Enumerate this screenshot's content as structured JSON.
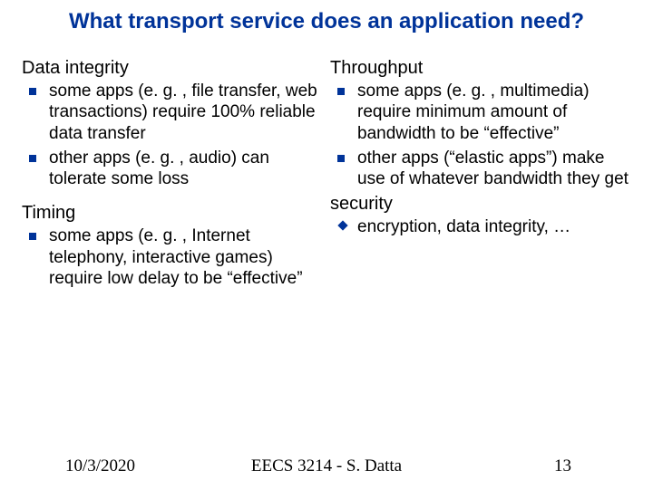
{
  "title": "What transport service does an application need?",
  "left": {
    "h1": "Data integrity",
    "b1": "some apps (e. g. , file transfer, web transactions) require 100% reliable data transfer",
    "b2": "other apps (e. g. , audio) can tolerate some loss",
    "h2": "Timing",
    "b3": "some apps (e. g. , Internet telephony, interactive games) require low delay to be “effective”"
  },
  "right": {
    "h1": "Throughput",
    "b1": "some apps (e. g. , multimedia) require minimum amount of bandwidth to be “effective”",
    "b2": "other apps (“elastic apps”) make use of whatever bandwidth they get",
    "h2": "security",
    "b3": "encryption, data integrity, …"
  },
  "footer": {
    "date": "10/3/2020",
    "course": "EECS 3214 - S. Datta",
    "page": "13"
  }
}
